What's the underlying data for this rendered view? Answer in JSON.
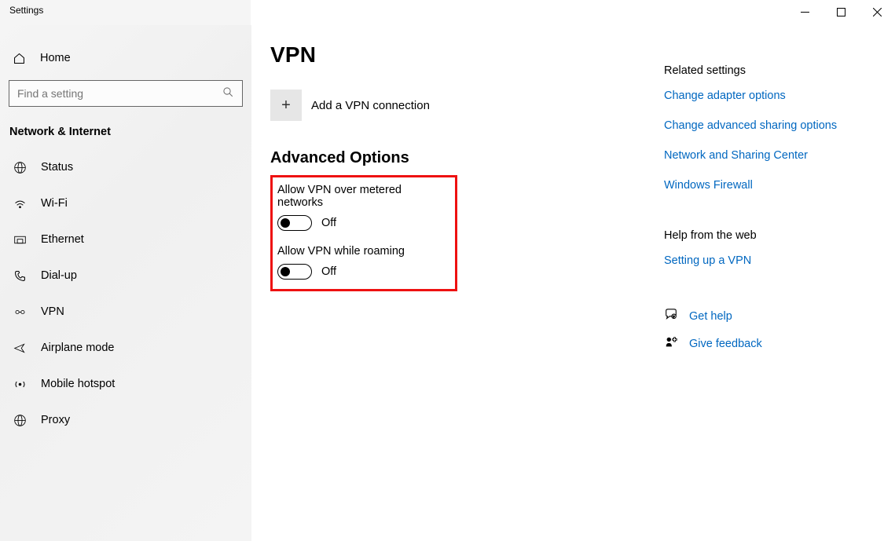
{
  "window": {
    "title": "Settings"
  },
  "sidebar": {
    "home": "Home",
    "search_placeholder": "Find a setting",
    "section": "Network & Internet",
    "items": [
      {
        "label": "Status"
      },
      {
        "label": "Wi-Fi"
      },
      {
        "label": "Ethernet"
      },
      {
        "label": "Dial-up"
      },
      {
        "label": "VPN"
      },
      {
        "label": "Airplane mode"
      },
      {
        "label": "Mobile hotspot"
      },
      {
        "label": "Proxy"
      }
    ]
  },
  "main": {
    "title": "VPN",
    "add_label": "Add a VPN connection",
    "advanced_header": "Advanced Options",
    "settings": [
      {
        "label": "Allow VPN over metered networks",
        "state": "Off"
      },
      {
        "label": "Allow VPN while roaming",
        "state": "Off"
      }
    ]
  },
  "related": {
    "header": "Related settings",
    "links": [
      "Change adapter options",
      "Change advanced sharing options",
      "Network and Sharing Center",
      "Windows Firewall"
    ]
  },
  "help": {
    "header": "Help from the web",
    "link": "Setting up a VPN",
    "get_help": "Get help",
    "feedback": "Give feedback"
  }
}
